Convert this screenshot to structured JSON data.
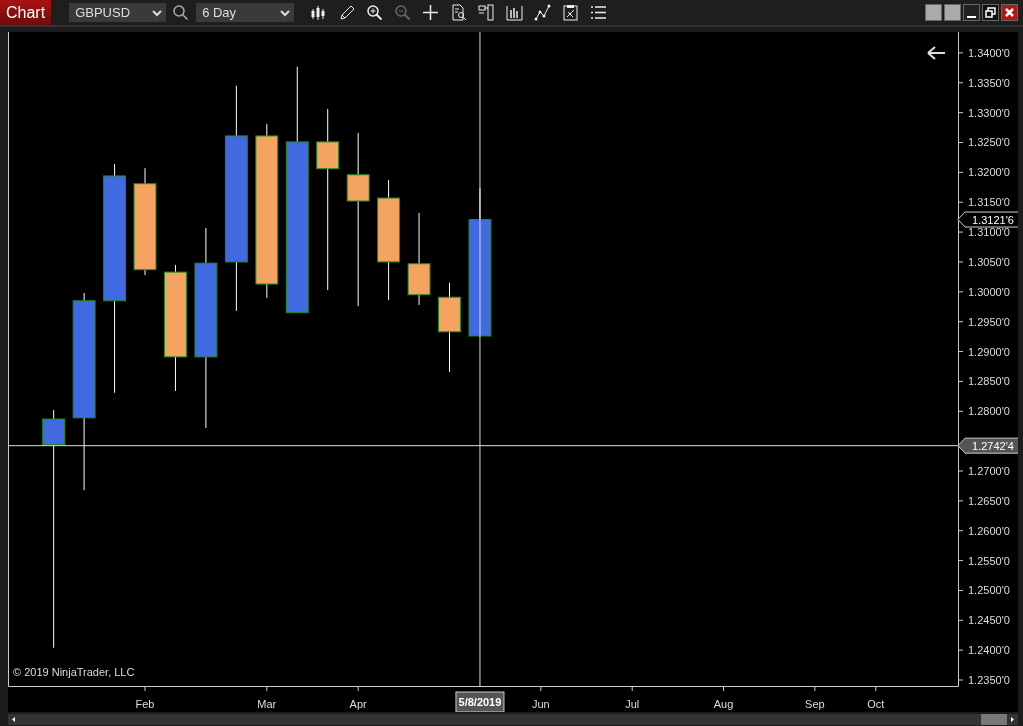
{
  "toolbar": {
    "tab": "Chart",
    "instrument": "GBPUSD",
    "interval": "6 Day",
    "tools": [
      {
        "kind": "candles",
        "disabled": false
      },
      {
        "kind": "pencil",
        "disabled": false
      },
      {
        "kind": "zoom-in",
        "disabled": false
      },
      {
        "kind": "zoom-out",
        "disabled": true
      },
      {
        "kind": "crosshair",
        "disabled": false
      },
      {
        "kind": "data-box",
        "disabled": false
      },
      {
        "kind": "properties",
        "disabled": false
      },
      {
        "kind": "bars",
        "disabled": false
      },
      {
        "kind": "strategy",
        "disabled": false
      },
      {
        "kind": "template",
        "disabled": false
      },
      {
        "kind": "list",
        "disabled": false
      }
    ],
    "window_buttons": [
      {
        "kind": "blank"
      },
      {
        "kind": "blank"
      },
      {
        "kind": "minimize"
      },
      {
        "kind": "restore"
      },
      {
        "kind": "close"
      }
    ]
  },
  "chart": {
    "copyright": "© 2019 NinjaTrader, LLC",
    "last_price_label": "1.3121'6",
    "crosshair": {
      "price_label": "1.2742'4",
      "date_label": "5/8/2019"
    },
    "price_axis_labels": [
      "1.3400'0",
      "1.3350'0",
      "1.3300'0",
      "1.3250'0",
      "1.3200'0",
      "1.3150'0",
      "1.3100'0",
      "1.3050'0",
      "1.3000'0",
      "1.2950'0",
      "1.2900'0",
      "1.2850'0",
      "1.2800'0",
      "1.2700'0",
      "1.2650'0",
      "1.2600'0",
      "1.2550'0",
      "1.2500'0",
      "1.2450'0",
      "1.2400'0",
      "1.2350'0"
    ],
    "date_axis_labels": [
      "Feb",
      "Mar",
      "Apr",
      "Jun",
      "Jul",
      "Aug",
      "Sep",
      "Oct"
    ]
  }
}
